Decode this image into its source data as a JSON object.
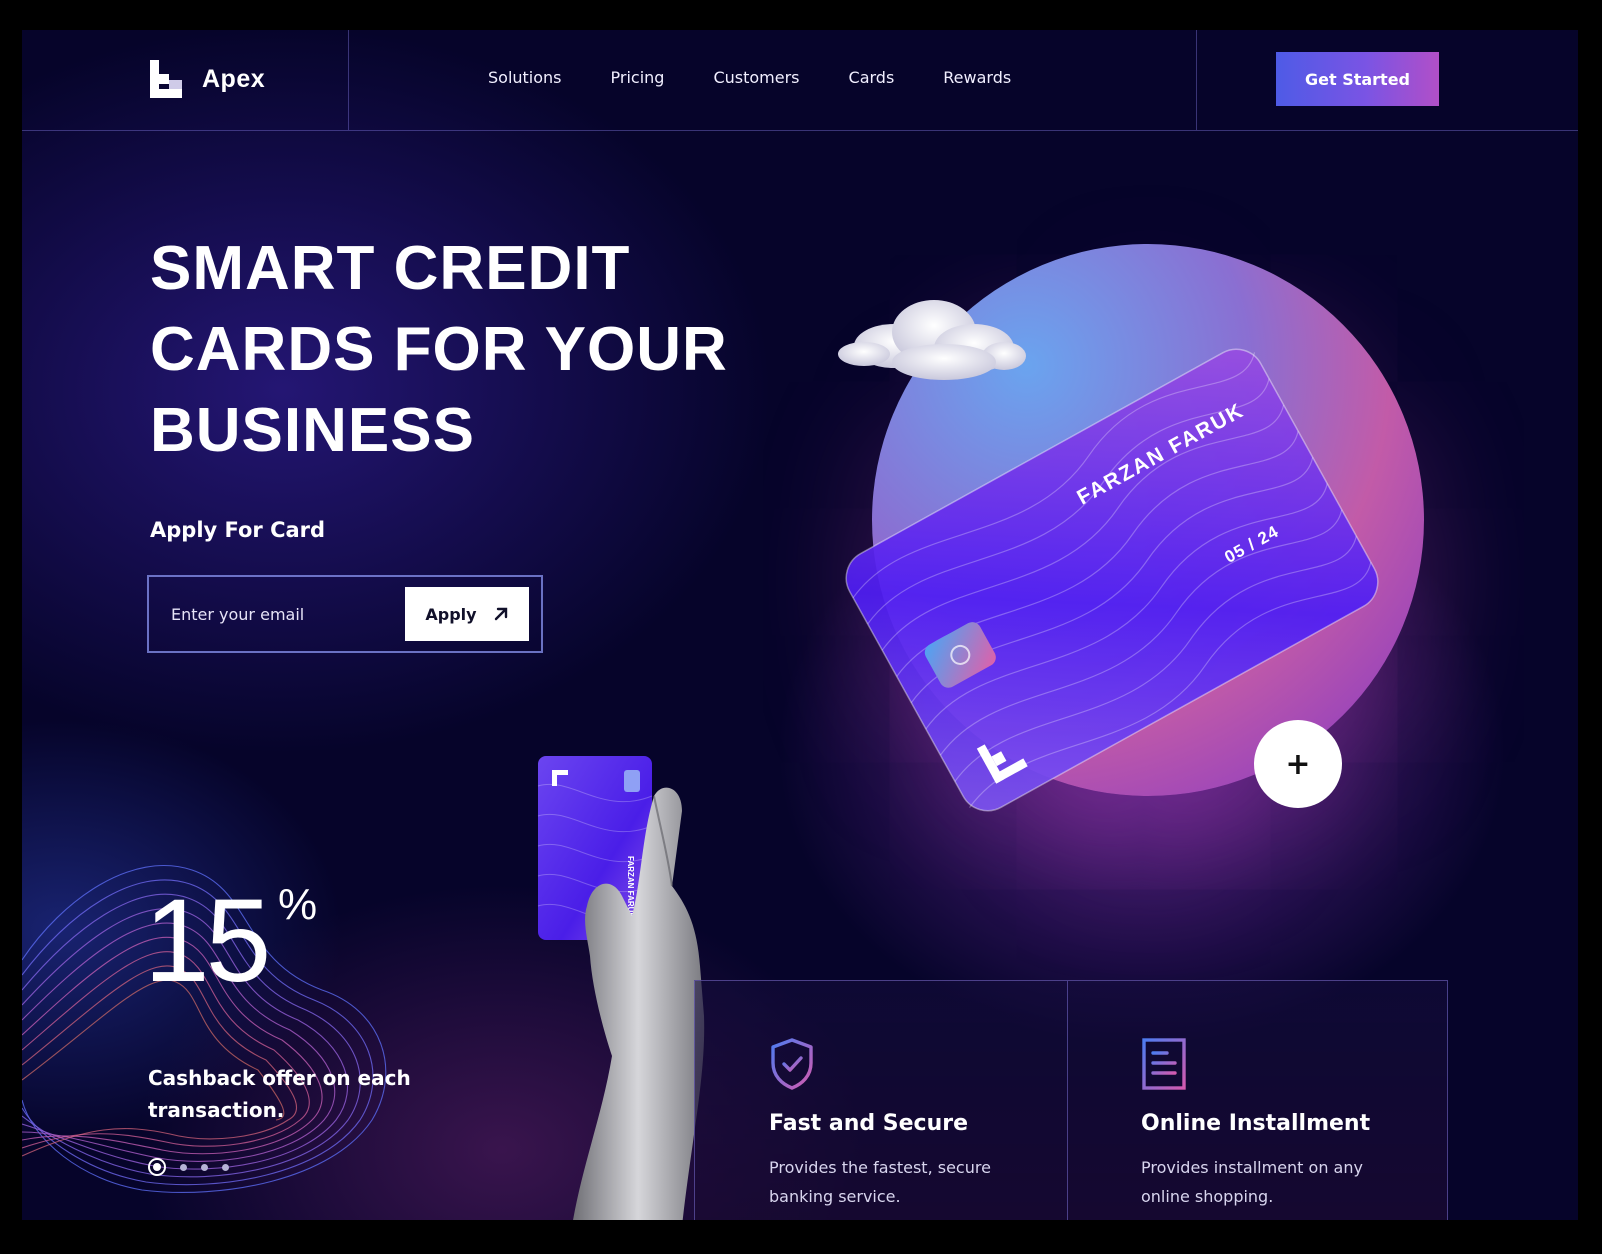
{
  "brand": {
    "name": "Apex"
  },
  "nav": {
    "items": [
      "Solutions",
      "Pricing",
      "Customers",
      "Cards",
      "Rewards"
    ],
    "cta_label": "Get Started"
  },
  "hero": {
    "title": "SMART CREDIT CARDS FOR YOUR BUSINESS",
    "apply_label": "Apply For Card",
    "email_placeholder": "Enter your email",
    "apply_button": "Apply"
  },
  "card": {
    "holder_name": "FARZAN FARUK",
    "expiry": "05 / 24"
  },
  "promo": {
    "value": "15",
    "unit": "%",
    "description": "Cashback offer on each transaction.",
    "slides_total": 4,
    "slide_active": 1
  },
  "features": [
    {
      "icon": "shield-check-icon",
      "title": "Fast and Secure",
      "description": "Provides the fastest, secure banking service."
    },
    {
      "icon": "document-icon",
      "title": "Online Installment",
      "description": "Provides installment on any online shopping."
    }
  ],
  "colors": {
    "background": "#06042a",
    "accent_start": "#4e5be6",
    "accent_end": "#b14fc8",
    "card": "#5a2ef0"
  }
}
